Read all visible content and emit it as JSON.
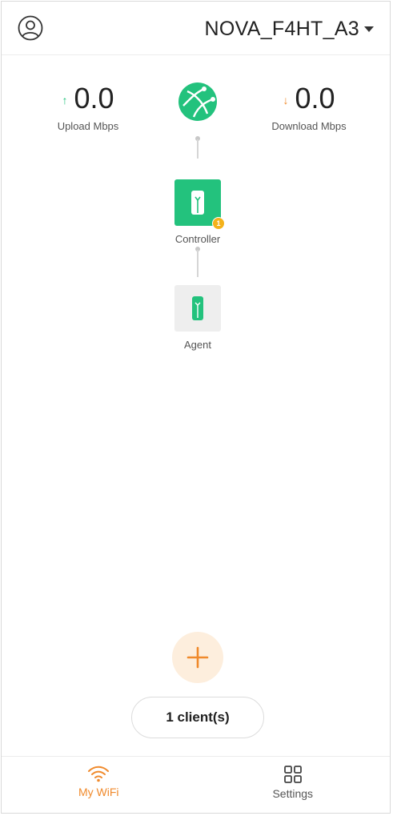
{
  "header": {
    "network_name": "NOVA_F4HT_A3",
    "avatar_icon": "user-circle-icon",
    "dropdown_icon": "caret-down-icon"
  },
  "speeds": {
    "upload": {
      "value": "0.0",
      "label": "Upload Mbps",
      "arrow": "↑",
      "icon": "arrow-up-icon",
      "color": "#1ec27a"
    },
    "download": {
      "value": "0.0",
      "label": "Download Mbps",
      "arrow": "↓",
      "icon": "arrow-down-icon",
      "color": "#f08a2c"
    }
  },
  "internet": {
    "icon": "globe-icon",
    "color": "#23c27d"
  },
  "topology": {
    "controller": {
      "label": "Controller",
      "badge": "1",
      "icon": "router-icon",
      "color": "#23c27d"
    },
    "agent": {
      "label": "Agent",
      "icon": "router-icon"
    }
  },
  "add_button": {
    "icon": "plus-icon",
    "color": "#f08a2c"
  },
  "clients_button": {
    "label": "1 client(s)"
  },
  "nav": {
    "items": [
      {
        "label": "My WiFi",
        "icon": "wifi-icon",
        "active": true
      },
      {
        "label": "Settings",
        "icon": "grid-icon",
        "active": false
      }
    ]
  },
  "colors": {
    "accent": "#f08a2c",
    "primary": "#23c27d"
  }
}
